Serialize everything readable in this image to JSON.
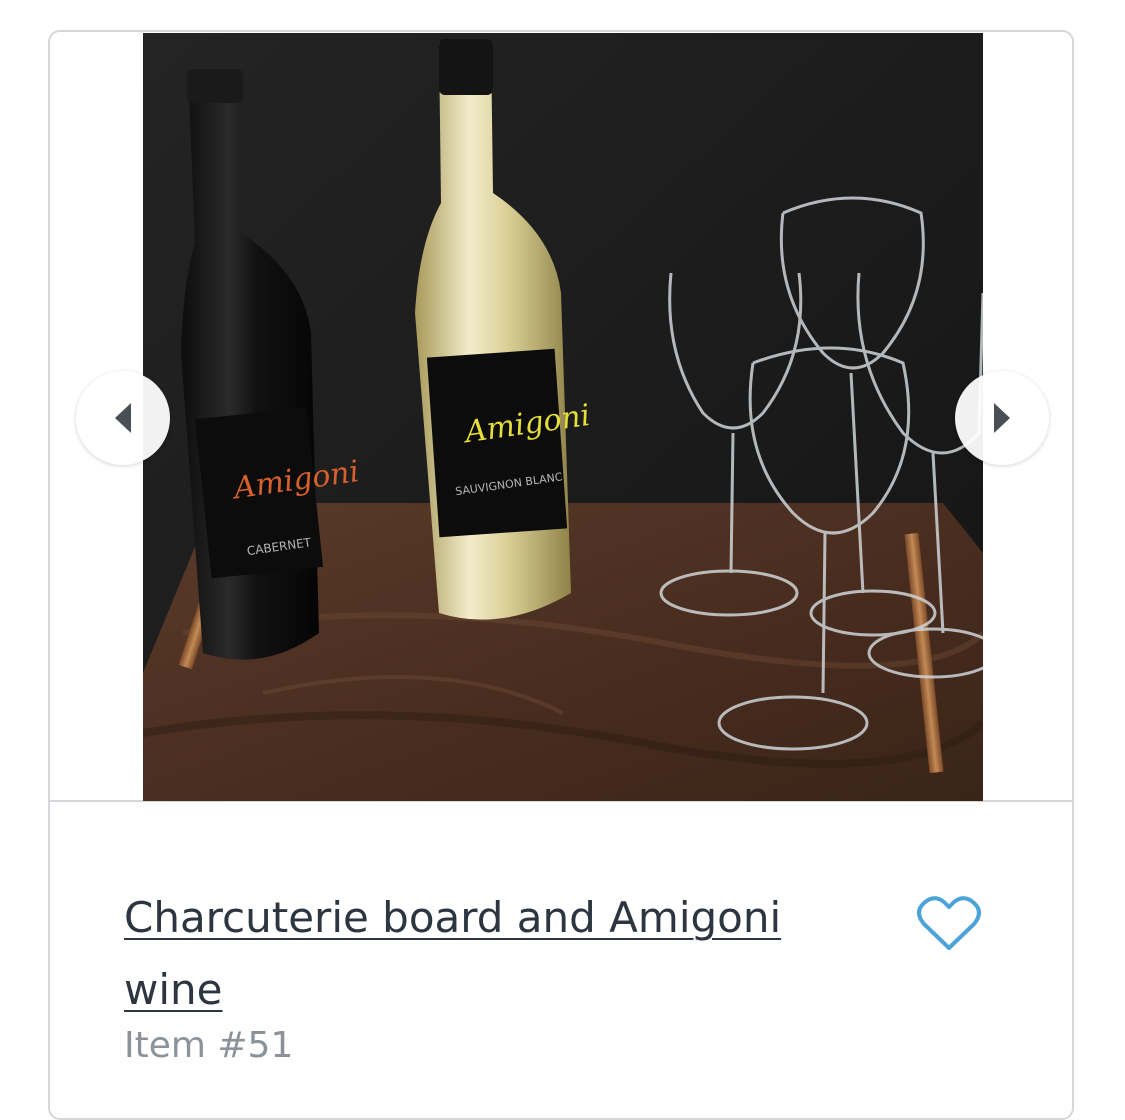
{
  "item": {
    "title": "Charcuterie board and Amigoni wine",
    "number_label": "Item #51",
    "image_alt": "Two Amigoni wine bottles and four wine glasses on a walnut tray"
  },
  "photo": {
    "red_bottle_label": {
      "brand": "Amigoni",
      "variety": "CABERNET"
    },
    "white_bottle_label": {
      "brand": "Amigoni",
      "variety": "SAUVIGNON BLANC"
    }
  },
  "carousel": {
    "prev_icon": "chevron-left-icon",
    "next_icon": "chevron-right-icon"
  },
  "favorite": {
    "icon": "heart-outline-icon"
  },
  "colors": {
    "title_text": "#2d3640",
    "muted_text": "#8b9299",
    "accent": "#4ba3d8",
    "border": "#d4d6d9"
  }
}
